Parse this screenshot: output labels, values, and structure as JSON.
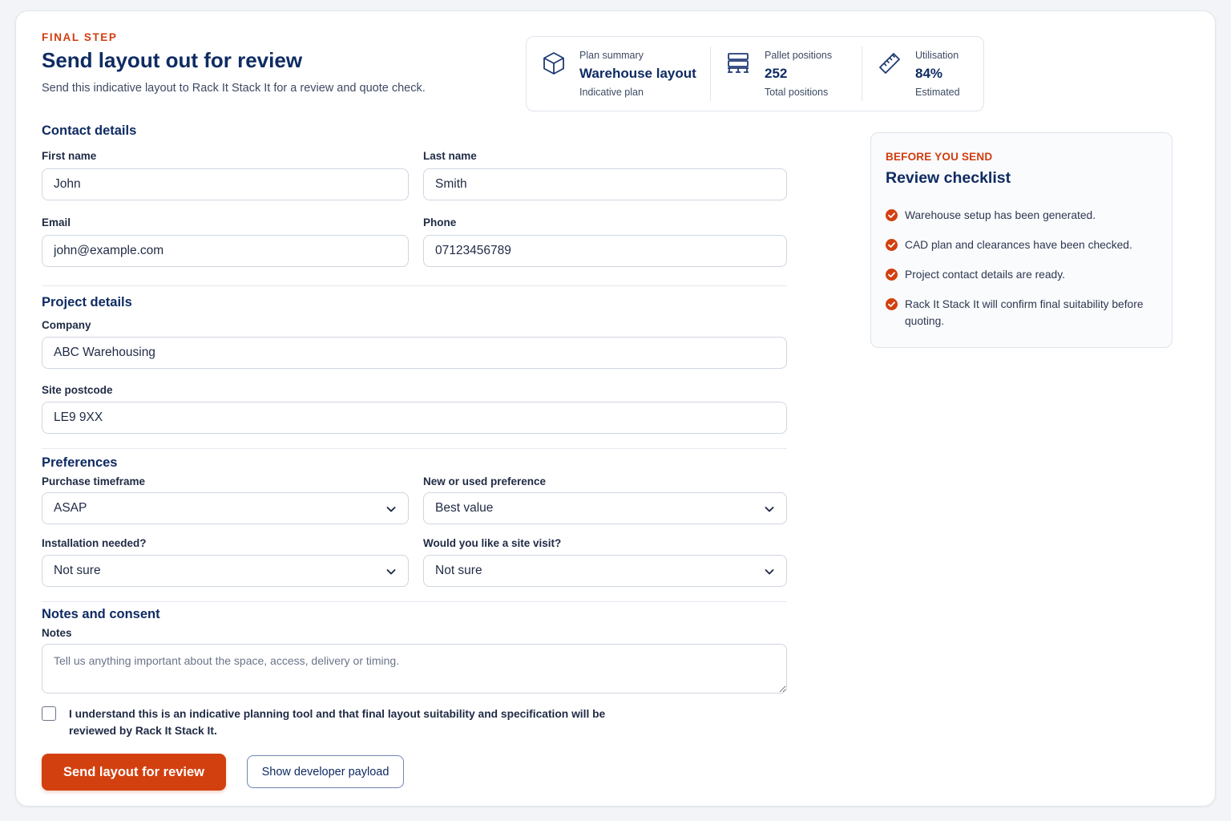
{
  "header": {
    "eyebrow": "FINAL STEP",
    "title": "Send layout out for review",
    "subtitle": "Send this indicative layout to Rack It Stack It for a review and quote check."
  },
  "summary": {
    "plan": {
      "label": "Plan summary",
      "value": "Warehouse layout",
      "sub": "Indicative plan",
      "icon": "cube-icon"
    },
    "pallets": {
      "label": "Pallet positions",
      "value": "252",
      "sub": "Total positions",
      "icon": "pallet-rack-icon"
    },
    "utilisation": {
      "label": "Utilisation",
      "value": "84%",
      "sub": "Estimated",
      "icon": "ruler-icon"
    }
  },
  "contact": {
    "title": "Contact details",
    "first_name": {
      "label": "First name",
      "value": "John"
    },
    "last_name": {
      "label": "Last name",
      "value": "Smith"
    },
    "email": {
      "label": "Email",
      "value": "john@example.com"
    },
    "phone": {
      "label": "Phone",
      "value": "07123456789"
    }
  },
  "project": {
    "title": "Project details",
    "company": {
      "label": "Company",
      "value": "ABC Warehousing"
    },
    "postcode": {
      "label": "Site postcode",
      "value": "LE9 9XX"
    }
  },
  "preferences": {
    "title": "Preferences",
    "timeframe": {
      "label": "Purchase timeframe",
      "value": "ASAP"
    },
    "new_used": {
      "label": "New or used preference",
      "value": "Best value"
    },
    "installation": {
      "label": "Installation needed?",
      "value": "Not sure"
    },
    "site_visit": {
      "label": "Would you like a site visit?",
      "value": "Not sure"
    }
  },
  "notes": {
    "title": "Notes and consent",
    "label": "Notes",
    "placeholder": "Tell us anything important about the space, access, delivery or timing.",
    "consent": "I understand this is an indicative planning tool and that final layout suitability and specification will be reviewed by Rack It Stack It."
  },
  "actions": {
    "send": "Send layout for review",
    "payload": "Show developer payload"
  },
  "checklist": {
    "eyebrow": "BEFORE YOU SEND",
    "title": "Review checklist",
    "items": [
      "Warehouse setup has been generated.",
      "CAD plan and clearances have been checked.",
      "Project contact details are ready.",
      "Rack It Stack It will confirm final suitability before quoting."
    ]
  },
  "colors": {
    "accent": "#d2400f",
    "navy": "#0f2b63"
  }
}
